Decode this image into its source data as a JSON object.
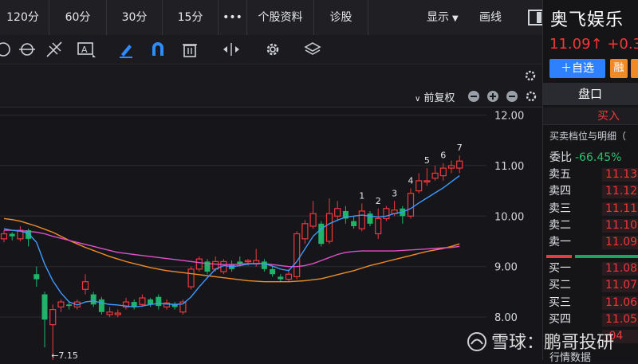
{
  "toolbar_top": {
    "tabs": [
      "120分",
      "60分",
      "30分",
      "15分",
      "•••",
      "个股资料",
      "诊股"
    ],
    "display_label": "显示",
    "draw_label": "画线"
  },
  "subbar": {
    "fuquan_label": "前复权"
  },
  "stock": {
    "name": "奥飞娱乐",
    "price_change": "11.09↑ +0.3",
    "add_watch_label": "＋自选",
    "margin_label": "融"
  },
  "panel": {
    "pankou_label": "盘口",
    "buy_in_label": "买入",
    "depth_title": "买卖档位与明细（",
    "weibi_label": "委比",
    "weibi_value": "-66.45%",
    "sells": [
      {
        "label": "卖五",
        "price": "11.13"
      },
      {
        "label": "卖四",
        "price": "11.12"
      },
      {
        "label": "卖三",
        "price": "11.11"
      },
      {
        "label": "卖二",
        "price": "11.10"
      },
      {
        "label": "卖一",
        "price": "11.09"
      }
    ],
    "buys": [
      {
        "label": "买一",
        "price": "11.08"
      },
      {
        "label": "买二",
        "price": "11.07"
      },
      {
        "label": "买三",
        "price": "11.06"
      },
      {
        "label": "买四",
        "price": "11.05"
      },
      {
        "label": "",
        "price": ".04"
      }
    ],
    "market_label": "行情数据"
  },
  "watermark": "雪球：鹏哥投研",
  "colors": {
    "up": "#f0383c",
    "down": "#1fb46a",
    "ma5": "#3d9bff",
    "ma10": "#e04fc8",
    "ma20": "#f08c28",
    "accent": "#2f80ff"
  },
  "chart_data": {
    "type": "candlestick",
    "y_axis_labels": [
      "12.00",
      "11.00",
      "10.00",
      "9.00",
      "8.00"
    ],
    "yticks": [
      12,
      11,
      10,
      9,
      8
    ],
    "ylim": [
      7.15,
      12.15
    ],
    "low_annotation": "←7.15",
    "count_labels": [
      "1",
      "2",
      "3",
      "4",
      "5",
      "6",
      "7"
    ],
    "count_label_bars": [
      44,
      46,
      48,
      50,
      52,
      54,
      56
    ],
    "candles": [
      [
        9.55,
        9.65,
        9.72,
        9.48
      ],
      [
        9.65,
        9.6,
        9.68,
        9.52
      ],
      [
        9.55,
        9.72,
        9.8,
        9.5
      ],
      [
        9.72,
        9.55,
        9.75,
        9.4
      ],
      [
        8.85,
        8.75,
        9.0,
        8.6
      ],
      [
        8.45,
        7.95,
        8.5,
        7.4
      ],
      [
        7.85,
        8.15,
        8.25,
        7.15
      ],
      [
        8.2,
        8.3,
        8.35,
        8.1
      ],
      [
        8.25,
        8.22,
        8.3,
        8.15
      ],
      [
        8.2,
        8.3,
        8.35,
        8.15
      ],
      [
        8.55,
        8.7,
        8.85,
        8.45
      ],
      [
        8.45,
        8.25,
        8.5,
        8.2
      ],
      [
        8.35,
        8.1,
        8.4,
        8.05
      ],
      [
        8.05,
        8.1,
        8.2,
        8.0
      ],
      [
        8.05,
        8.08,
        8.15,
        8.0
      ],
      [
        8.2,
        8.3,
        8.38,
        8.15
      ],
      [
        8.3,
        8.2,
        8.35,
        8.15
      ],
      [
        8.25,
        8.38,
        8.45,
        8.2
      ],
      [
        8.35,
        8.25,
        8.38,
        8.2
      ],
      [
        8.4,
        8.22,
        8.45,
        8.15
      ],
      [
        8.2,
        8.28,
        8.35,
        8.15
      ],
      [
        8.25,
        8.2,
        8.3,
        8.15
      ],
      [
        8.1,
        8.3,
        8.35,
        8.05
      ],
      [
        8.6,
        8.95,
        9.0,
        8.55
      ],
      [
        8.95,
        9.15,
        9.2,
        8.9
      ],
      [
        9.1,
        8.9,
        9.15,
        8.85
      ],
      [
        8.95,
        9.1,
        9.2,
        8.9
      ],
      [
        8.9,
        9.1,
        9.15,
        8.85
      ],
      [
        9.05,
        8.95,
        9.12,
        8.9
      ],
      [
        9.1,
        9.05,
        9.2,
        9.0
      ],
      [
        9.1,
        9.12,
        9.15,
        9.02
      ],
      [
        9.05,
        9.12,
        9.35,
        9.0
      ],
      [
        9.1,
        8.95,
        9.15,
        8.9
      ],
      [
        8.95,
        8.85,
        9.0,
        8.8
      ],
      [
        8.8,
        8.75,
        8.85,
        8.7
      ],
      [
        8.75,
        8.85,
        8.95,
        8.7
      ],
      [
        8.8,
        9.65,
        9.7,
        8.75
      ],
      [
        9.55,
        9.85,
        9.92,
        9.45
      ],
      [
        9.8,
        10.05,
        10.3,
        9.75
      ],
      [
        9.85,
        9.45,
        9.9,
        9.4
      ],
      [
        9.5,
        10.05,
        10.35,
        9.45
      ],
      [
        10.0,
        10.15,
        10.3,
        9.9
      ],
      [
        10.1,
        9.95,
        10.2,
        9.85
      ],
      [
        9.9,
        9.8,
        10.0,
        9.75
      ],
      [
        9.75,
        10.1,
        10.25,
        9.7
      ],
      [
        10.05,
        9.85,
        10.1,
        9.8
      ],
      [
        9.65,
        9.95,
        10.15,
        9.55
      ],
      [
        9.95,
        10.15,
        10.2,
        9.9
      ],
      [
        10.05,
        10.12,
        10.3,
        10.0
      ],
      [
        10.15,
        10.0,
        10.2,
        9.85
      ],
      [
        10.0,
        10.45,
        10.55,
        9.95
      ],
      [
        10.5,
        10.7,
        10.85,
        10.45
      ],
      [
        10.7,
        10.7,
        10.95,
        10.6
      ],
      [
        10.75,
        10.85,
        11.0,
        10.7
      ],
      [
        10.8,
        10.95,
        11.05,
        10.7
      ],
      [
        10.95,
        11.0,
        11.1,
        10.85
      ],
      [
        10.95,
        11.09,
        11.2,
        10.85
      ]
    ],
    "ma5": [
      9.75,
      9.72,
      9.7,
      9.66,
      9.48,
      9.05,
      8.72,
      8.48,
      8.3,
      8.24,
      8.3,
      8.32,
      8.28,
      8.25,
      8.24,
      8.22,
      8.2,
      8.22,
      8.25,
      8.27,
      8.26,
      8.25,
      8.26,
      8.4,
      8.6,
      8.78,
      8.95,
      9.02,
      9.0,
      9.02,
      9.05,
      9.06,
      9.06,
      9.01,
      8.95,
      8.92,
      9.1,
      9.35,
      9.6,
      9.75,
      9.85,
      9.92,
      9.98,
      10.0,
      10.02,
      10.0,
      9.98,
      10.0,
      10.05,
      10.08,
      10.15,
      10.26,
      10.36,
      10.46,
      10.56,
      10.68,
      10.8
    ],
    "ma10": [
      9.72,
      9.72,
      9.71,
      9.7,
      9.68,
      9.65,
      9.6,
      9.56,
      9.52,
      9.48,
      9.44,
      9.4,
      9.36,
      9.32,
      9.28,
      9.26,
      9.24,
      9.22,
      9.2,
      9.18,
      9.16,
      9.14,
      9.12,
      9.1,
      9.08,
      9.06,
      9.05,
      9.04,
      9.04,
      9.05,
      9.06,
      9.06,
      9.06,
      9.04,
      9.02,
      9.0,
      9.0,
      9.02,
      9.06,
      9.12,
      9.18,
      9.24,
      9.28,
      9.3,
      9.31,
      9.31,
      9.31,
      9.31,
      9.31,
      9.32,
      9.33,
      9.34,
      9.35,
      9.36,
      9.37,
      9.38,
      9.4
    ],
    "ma20": [
      9.95,
      9.93,
      9.9,
      9.85,
      9.8,
      9.74,
      9.68,
      9.6,
      9.52,
      9.45,
      9.38,
      9.32,
      9.26,
      9.2,
      9.15,
      9.1,
      9.06,
      9.02,
      8.98,
      8.95,
      8.92,
      8.9,
      8.88,
      8.86,
      8.84,
      8.82,
      8.8,
      8.78,
      8.76,
      8.74,
      8.72,
      8.71,
      8.7,
      8.7,
      8.7,
      8.7,
      8.71,
      8.72,
      8.74,
      8.76,
      8.8,
      8.84,
      8.88,
      8.92,
      8.97,
      9.02,
      9.06,
      9.1,
      9.14,
      9.18,
      9.22,
      9.26,
      9.3,
      9.33,
      9.36,
      9.4,
      9.45
    ]
  }
}
